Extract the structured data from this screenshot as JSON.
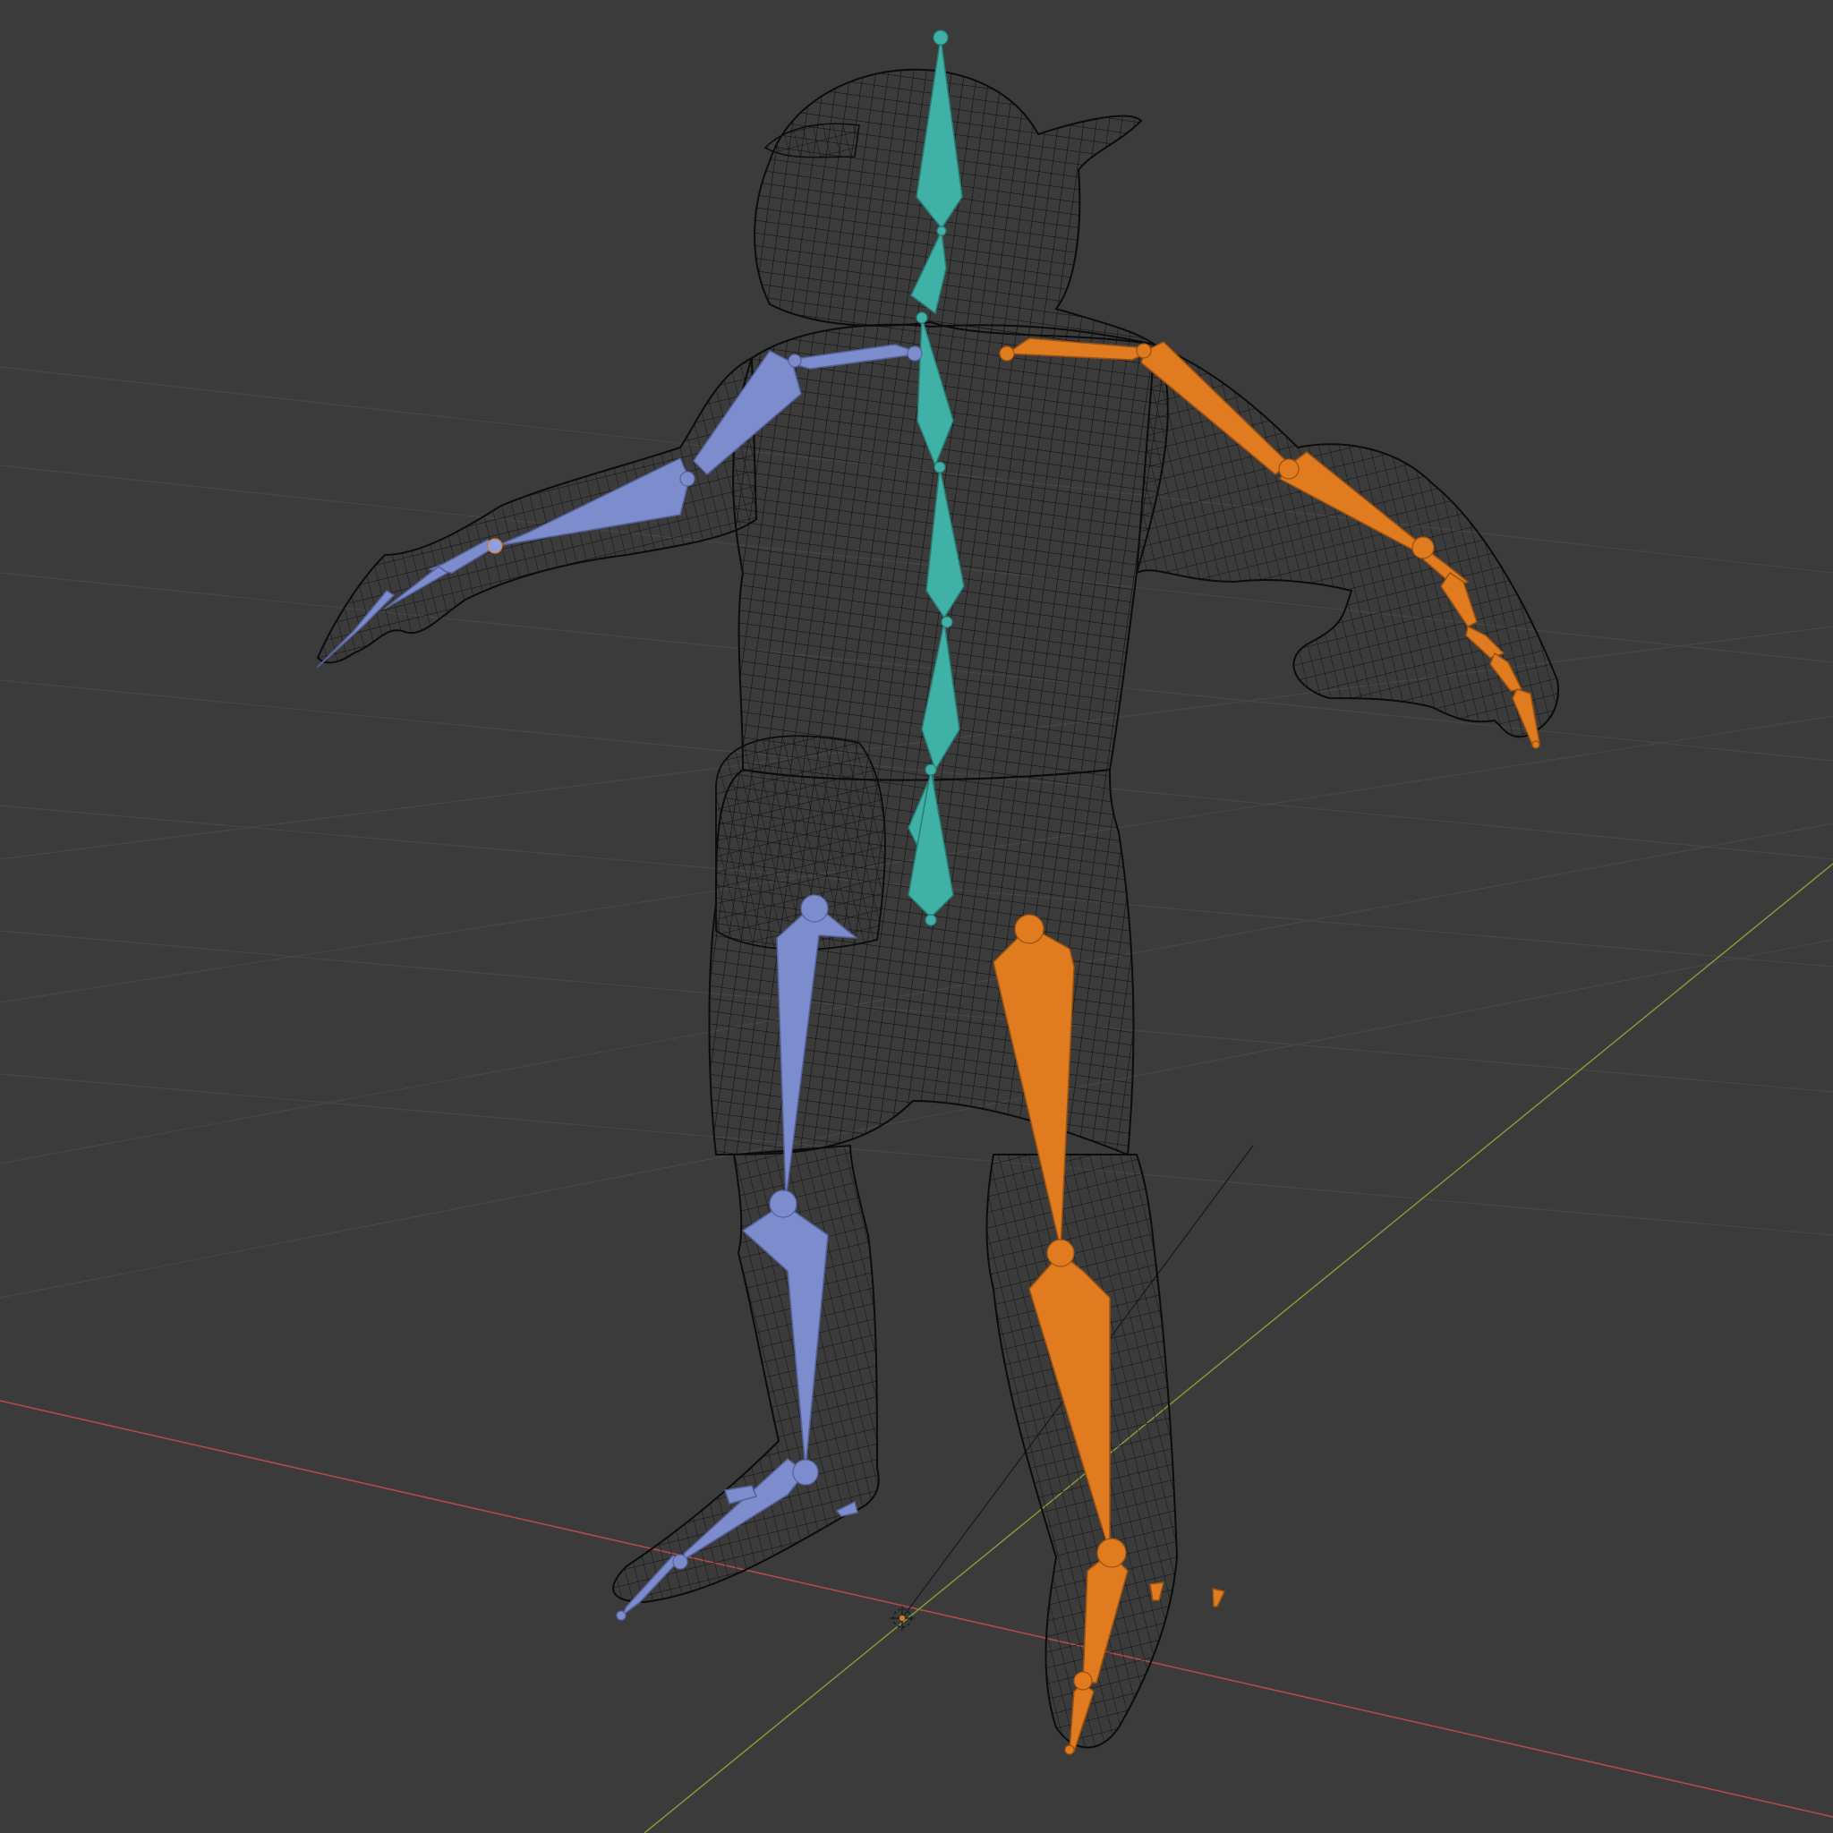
{
  "viewport": {
    "background": "#3b3b3b",
    "grid_color": "#474747",
    "x_axis_color": "#b84a4a",
    "y_axis_color": "#7f9a36",
    "mesh_color": "#0c0c0c"
  },
  "armature": {
    "spine_color": "#3fb1a6",
    "left_color": "#7c8ccc",
    "right_color": "#e07b20"
  },
  "icons": {
    "origin": "3d-cursor-icon"
  }
}
